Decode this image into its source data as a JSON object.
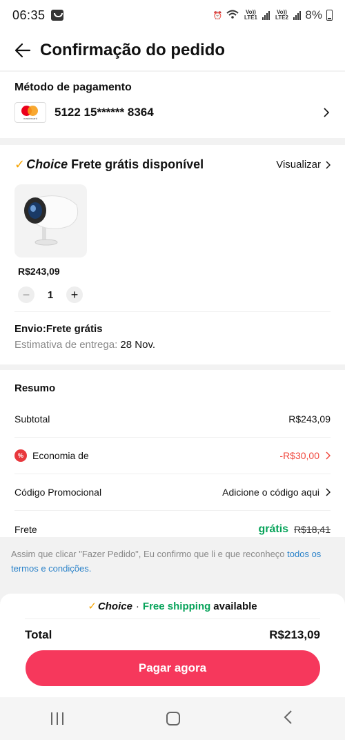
{
  "status_bar": {
    "time": "06:35",
    "lte1": "Vo)) LTE1",
    "lte2": "Vo)) LTE2",
    "battery": "8%"
  },
  "header": {
    "title": "Confirmação do pedido"
  },
  "payment": {
    "label": "Método de pagamento",
    "card_brand": "mastercard",
    "card_number": "5122 15****** 8364"
  },
  "choice": {
    "brand": "Choice",
    "text": "Frete grátis disponível",
    "view_label": "Visualizar"
  },
  "product": {
    "price": "R$243,09",
    "quantity": "1",
    "minus": "−",
    "plus": "+"
  },
  "shipping": {
    "title": "Envio:Frete grátis",
    "estimate_label": "Estimativa de entrega:",
    "estimate_date": "28 Nov."
  },
  "summary": {
    "title": "Resumo",
    "subtotal_label": "Subtotal",
    "subtotal_value": "R$243,09",
    "savings_label": "Economia de",
    "savings_value": "-R$30,00",
    "promo_label": "Código Promocional",
    "promo_value": "Adicione o código aqui",
    "freight_label": "Frete",
    "freight_free": "grátis",
    "freight_old": "R$18,41"
  },
  "terms": {
    "text": "Assim que clicar \"Fazer Pedido\", Eu confirmo que li e que reconheço ",
    "link": "todos os termos e condições."
  },
  "footer": {
    "banner_brand": "Choice",
    "banner_dot": "·",
    "banner_free": "Free shipping",
    "banner_avail": "available",
    "total_label": "Total",
    "total_value": "R$213,09",
    "pay_button": "Pagar agora"
  },
  "colors": {
    "accent": "#f6385c",
    "green": "#07a35a",
    "red": "#f0483e",
    "choice_check": "#f5a300",
    "link": "#2a82c9"
  }
}
